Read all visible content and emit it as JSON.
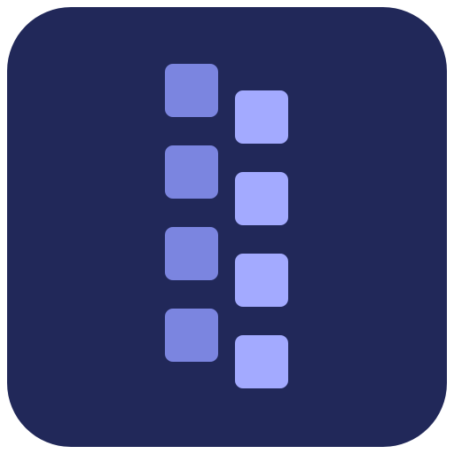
{
  "icon": {
    "name": "zip-archive-app-icon",
    "background_color": "#212859",
    "zipper_teeth": {
      "left_color": "#7b85e0",
      "right_color": "#a3aaff",
      "left_count": 4,
      "right_count": 4
    }
  }
}
